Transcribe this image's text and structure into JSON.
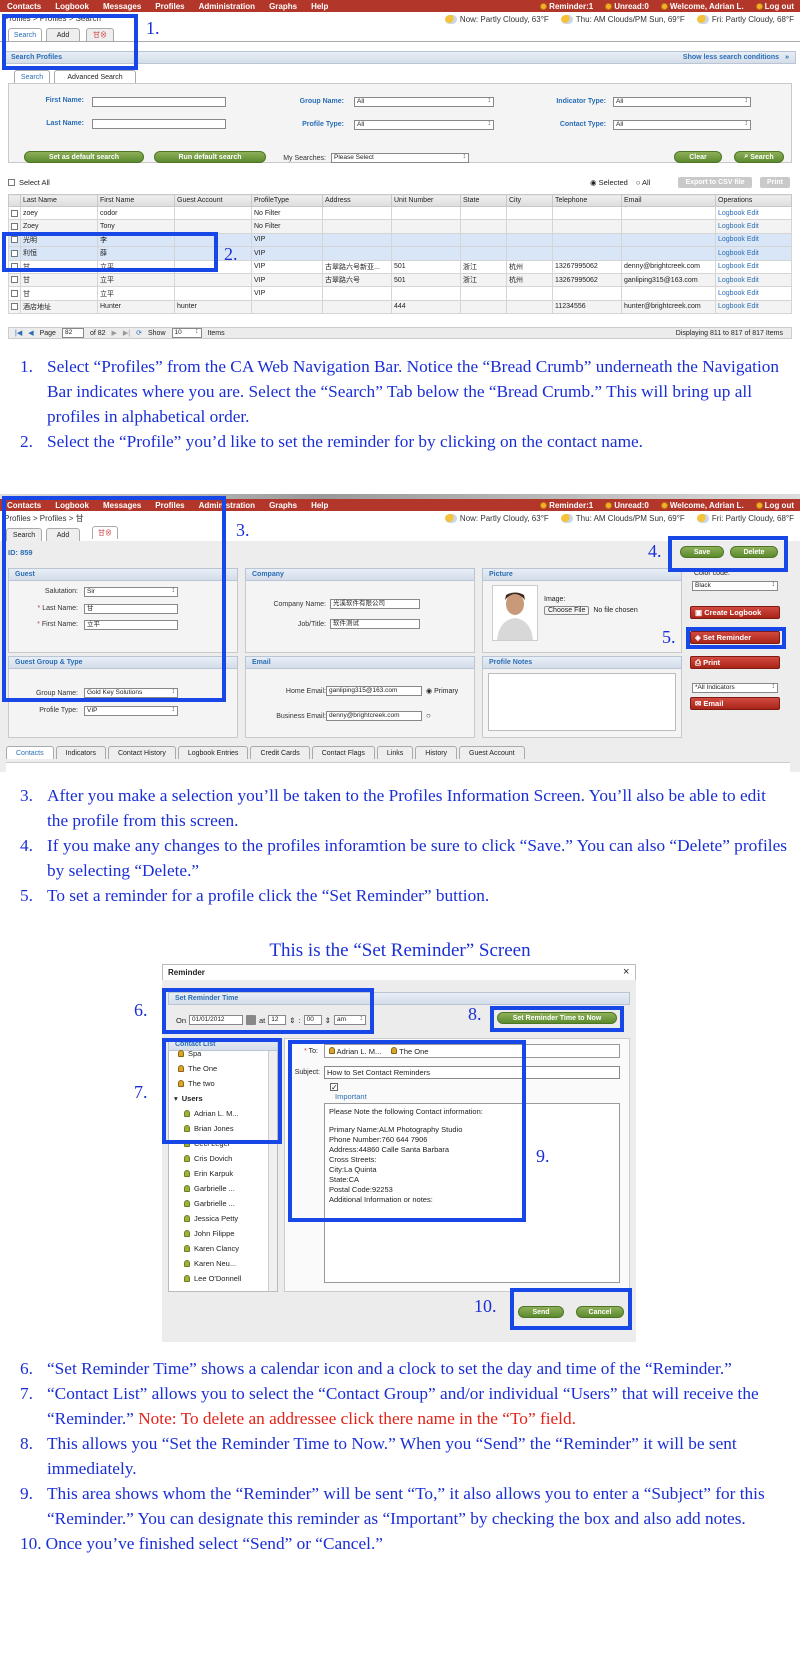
{
  "nav": {
    "items": [
      "Contacts",
      "Logbook",
      "Messages",
      "Profiles",
      "Administration",
      "Graphs",
      "Help"
    ],
    "reminder": "Reminder:1",
    "unread": "Unread:0",
    "welcome": "Welcome, Adrian L.",
    "logout": "Log out"
  },
  "weather": {
    "now": "Now: Partly Cloudy, 63°F",
    "thu": "Thu: AM Clouds/PM Sun, 69°F",
    "fri": "Fri: Partly Cloudy, 68°F"
  },
  "screen1": {
    "breadcrumb": "Profiles > Profiles > Search",
    "tabs": [
      "Search",
      "Add"
    ],
    "search_header": "Search Profiles",
    "show_less": "Show less search conditions",
    "subtabs": [
      "Search",
      "Advanced Search"
    ],
    "labels": {
      "first_name": "First Name:",
      "last_name": "Last Name:",
      "group_name": "Group Name:",
      "profile_type": "Profile Type:",
      "indicator_type": "Indicator Type:",
      "contact_type": "Contact Type:",
      "my_searches": "My Searches:"
    },
    "all_value": "All",
    "please_select": "Please Select",
    "buttons": {
      "set_default": "Set as default search",
      "run_default": "Run default search",
      "clear": "Clear",
      "search": "Search",
      "export": "Export to CSV file",
      "print": "Print"
    },
    "select_all": "Select All",
    "radio_selected": "Selected",
    "radio_all": "All",
    "columns": [
      "Last Name",
      "First Name",
      "Guest Account",
      "ProfileType",
      "Address",
      "Unit Number",
      "State",
      "City",
      "Telephone",
      "Email",
      "Operations"
    ],
    "rows": [
      [
        "zoey",
        "codor",
        "",
        "No Filter",
        "",
        "",
        "",
        "",
        "",
        "",
        ""
      ],
      [
        "Zoey",
        "Tony",
        "",
        "No Filter",
        "",
        "",
        "",
        "",
        "",
        "",
        ""
      ],
      [
        "光明",
        "李",
        "",
        "VIP",
        "",
        "",
        "",
        "",
        "",
        "",
        ""
      ],
      [
        "利恒",
        "薛",
        "",
        "VIP",
        "",
        "",
        "",
        "",
        "",
        "",
        ""
      ],
      [
        "甘",
        "立平",
        "",
        "VIP",
        "古翠路六号新亚...",
        "501",
        "浙江",
        "杭州",
        "13267995062",
        "denny@brightcreek.com",
        ""
      ],
      [
        "甘",
        "立平",
        "",
        "VIP",
        "古翠路六号",
        "501",
        "浙江",
        "杭州",
        "13267995062",
        "ganliping315@163.com",
        ""
      ],
      [
        "甘",
        "立平",
        "",
        "VIP",
        "",
        "",
        "",
        "",
        "",
        "",
        ""
      ],
      [
        "酒店地址",
        "Hunter",
        "hunter",
        "",
        "",
        "444",
        "",
        "",
        "11234556",
        "hunter@brightcreek.com",
        ""
      ]
    ],
    "op_logbook": "Logbook",
    "op_edit": "Edit",
    "pager": {
      "page_label": "Page",
      "page": "82",
      "of": "of 82",
      "show": "Show",
      "show_count": "10",
      "items": "Items",
      "displaying": "Displaying 811 to 817 of 817 Items"
    }
  },
  "steps": {
    "n1": "1.",
    "n2": "2.",
    "n3": "3.",
    "n4": "4.",
    "n5": "5.",
    "n6": "6.",
    "n7": "7.",
    "n8": "8.",
    "n9": "9.",
    "n10": "10."
  },
  "instructions1": [
    {
      "num": "1.",
      "text": "Select “Profiles” from the CA Web Navigation Bar. Notice the “Bread Crumb” underneath the Navigation Bar indicates where you are. Select the “Search” Tab below the “Bread Crumb.” This will bring up all profiles in alphabetical order."
    },
    {
      "num": "2.",
      "text": "Select the “Profile” you’d like to set the reminder for by clicking on the contact name."
    }
  ],
  "screen2": {
    "breadcrumb": "Profiles > Profiles > 甘",
    "tabs": [
      "Search",
      "Add"
    ],
    "id": "ID:  859",
    "save": "Save",
    "delete": "Delete",
    "guest": "Guest",
    "salutation_label": "Salutation:",
    "salutation": "Sir",
    "last_name_label": "Last Name:",
    "last_name": "甘",
    "first_name_label": "First Name:",
    "first_name": "立平",
    "company": "Company",
    "company_name_label": "Company Name:",
    "company_name": "光溪软件有限公司",
    "job_title_label": "Job/Title:",
    "job_title": "软件测试",
    "picture": "Picture",
    "image_label": "Image:",
    "choose_file": "Choose File",
    "no_file": "No file chosen",
    "color_code": "Color code:",
    "color_value": "Black",
    "create_logbook": "Create Logbook",
    "set_reminder": "Set Reminder",
    "print": "Print",
    "all_indicators": "*All Indicators",
    "email_btn": "Email",
    "group_type": "Guest Group & Type",
    "group_name_label": "Group Name:",
    "group_name": "Gold Key Solutions",
    "profile_type_label": "Profile Type:",
    "profile_type": "VIP",
    "email": "Email",
    "home_email_label": "Home Email:",
    "home_email": "ganliping315@163.com",
    "primary": "Primary",
    "business_email_label": "Business Email:",
    "business_email": "denny@brightcreek.com",
    "profile_notes": "Profile Notes",
    "bottom_tabs": [
      "Contacts",
      "Indicators",
      "Contact History",
      "Logbook Entries",
      "Credit Cards",
      "Contact Flags",
      "Links",
      "History",
      "Guest Account"
    ]
  },
  "instructions2": [
    {
      "num": "3.",
      "text": "After you make a selection you’ll be taken to the Profiles Information Screen. You’ll also be able to edit the profile from this screen."
    },
    {
      "num": "4.",
      "text": "If you make any changes to the profiles inforamtion be sure to click “Save.” You can also “Delete” profiles by selecting “Delete.”"
    },
    {
      "num": "5.",
      "text": "To set a reminder for a profile click the “Set Reminder” buttion."
    }
  ],
  "screen3": {
    "caption": "This is the “Set Reminder” Screen",
    "title": "Reminder",
    "close": "×",
    "set_time_header": "Set Reminder Time",
    "on": "On",
    "date": "01/01/2012",
    "at": "at",
    "hour": "12",
    "minute": "00",
    "ampm": "am",
    "now_btn": "Set Reminder Time to Now",
    "contact_list": "Contact List",
    "contacts": [
      "Spa",
      "The One",
      "The two",
      "Users",
      "Adrian L. M...",
      "Brian Jones",
      "Ceci Leger",
      "Cris Dovich",
      "Erin Karpuk",
      "Garbrielle ...",
      "Garbrielle ...",
      "Jessica Petty",
      "John Filippe",
      "Karen Clancy",
      "Karen Neu...",
      "Lee O'Donnell"
    ],
    "to_label": "To:",
    "to_values": [
      "Adrian L. M...",
      "The One"
    ],
    "subject_label": "Subject:",
    "subject": "How to Set Contact Reminders",
    "important": "Important",
    "notes": [
      "Please Note the following Contact information:",
      "",
      "Primary Name:ALM Photography Studio",
      "Phone Number:760 644 7906",
      "Address:44860 Calle Santa Barbara",
      "Cross Streets:",
      "City:La Quinta",
      "State:CA",
      "Postal Code:92253",
      "Additional Information or notes:"
    ],
    "send": "Send",
    "cancel": "Cancel"
  },
  "instructions3": [
    {
      "num": "6.",
      "text": "“Set Reminder Time” shows a calendar icon and a clock to set the day and time of the “Reminder.”"
    },
    {
      "num": "7.",
      "text": "“Contact List” allows you to select the “Contact Group” and/or individual “Users” that will receive the “Reminder.” ",
      "note": "Note: To delete an addressee click there name in the “To” field."
    },
    {
      "num": "8.",
      "text": "This allows you “Set the Reminder Time to Now.”  When you “Send” the “Reminder” it will be sent immediately."
    },
    {
      "num": "9.",
      "text": "This area shows whom the “Reminder” will be sent “To,” it also allows you to enter a “Subject” for this “Reminder.” You can designate this reminder as “Important” by checking the box and also add notes."
    },
    {
      "num": "10.",
      "text": "Once you’ve finished select “Send” or “Cancel.”"
    }
  ],
  "colors": {
    "nav_red": "#b3362a",
    "annotation_blue": "#1747e6",
    "text_blue": "#1a2fd6",
    "note_red": "#e2231a",
    "green_btn": "#5b8a2d"
  }
}
